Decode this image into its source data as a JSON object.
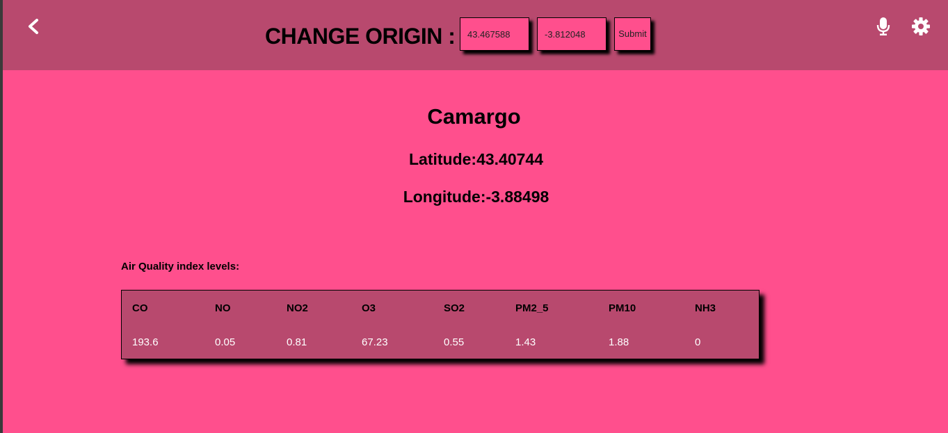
{
  "header": {
    "title": "CHANGE ORIGIN :",
    "latitude_value": "43.467588",
    "longitude_value": "-3.812048",
    "submit_label": "Submit",
    "back_icon": "chevron-left-icon",
    "mic_icon": "microphone-icon",
    "settings_icon": "gear-icon"
  },
  "location": {
    "city": "Camargo",
    "latitude_text": "Latitude:43.40744",
    "longitude_text": "Longitude:-3.88498"
  },
  "air_quality": {
    "label": "Air Quality index levels:",
    "columns": [
      "CO",
      "NO",
      "NO2",
      "O3",
      "SO2",
      "PM2_5",
      "PM10",
      "NH3"
    ],
    "values": [
      "193.6",
      "0.05",
      "0.81",
      "67.23",
      "0.55",
      "1.43",
      "1.88",
      "0"
    ]
  },
  "colors": {
    "header_bg": "#b8496e",
    "page_bg": "#ff4f8d",
    "table_bg": "#b8496e"
  }
}
